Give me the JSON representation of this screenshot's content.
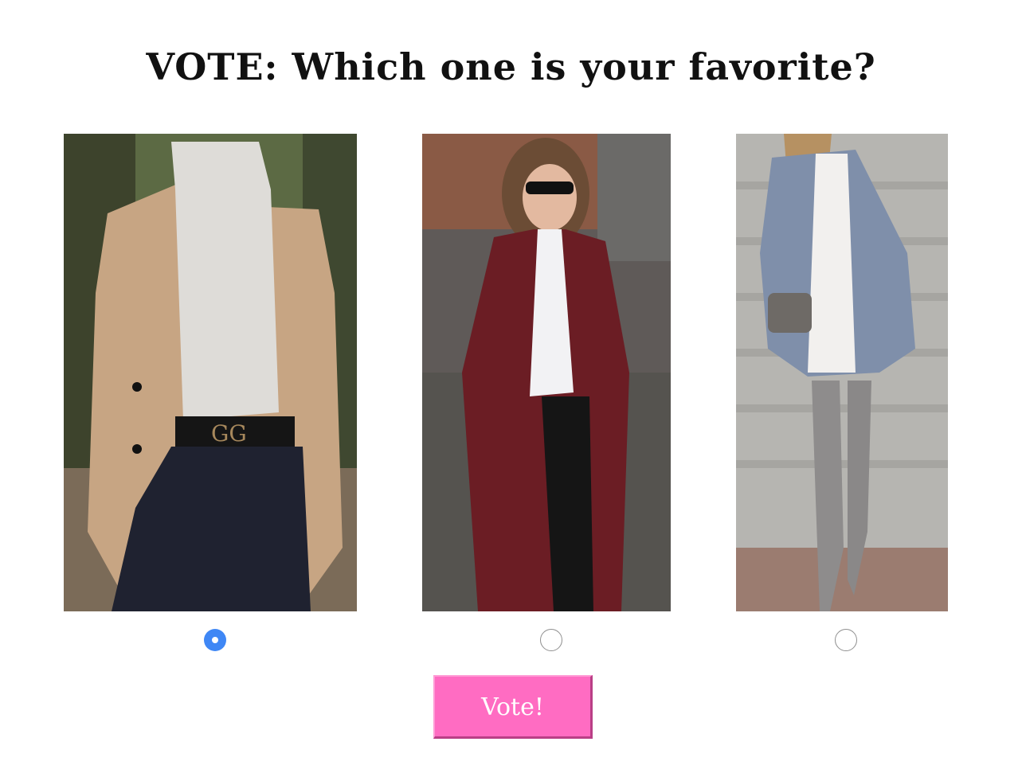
{
  "poll": {
    "title": "VOTE: Which one is your favorite?",
    "vote_button_label": "Vote!",
    "selected_index": 0,
    "accent_color": "#3f87f5",
    "button_color": "#ff6cc2"
  },
  "options": [
    {
      "icon": "camel-blazer-outfit-photo",
      "selected": true
    },
    {
      "icon": "burgundy-coat-outfit-photo",
      "selected": false
    },
    {
      "icon": "blue-coat-boots-outfit-photo",
      "selected": false
    }
  ]
}
